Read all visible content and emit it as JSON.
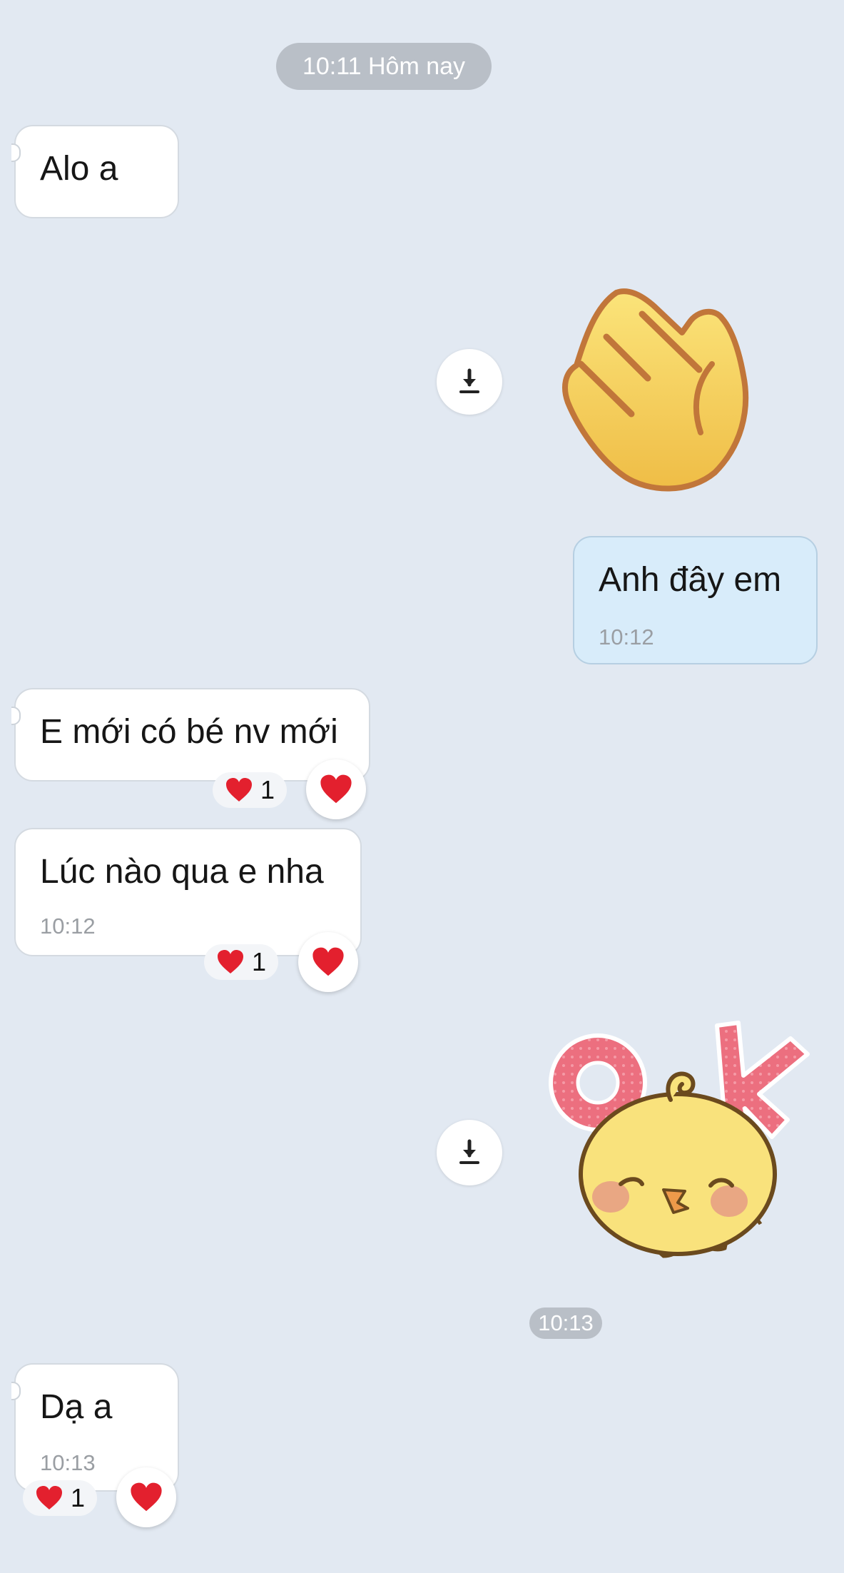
{
  "header_time": "10:11 Hôm nay",
  "messages": [
    {
      "text": "Alo a",
      "time": ""
    },
    {
      "text": "Anh đây em",
      "time": "10:12"
    },
    {
      "text": "E mới có bé nv mới",
      "time": ""
    },
    {
      "text": "Lúc nào qua e nha",
      "time": "10:12"
    },
    {
      "text": "Dạ a",
      "time": "10:13"
    }
  ],
  "mid_time": "10:13",
  "reactions": {
    "emoji": "❤️",
    "counts": [
      "1",
      "1",
      "1"
    ]
  },
  "stickers": [
    {
      "name": "waving-hand-sticker"
    },
    {
      "name": "ok-chick-sticker",
      "text": "OK"
    }
  ],
  "icons": {
    "download": "download-icon",
    "heart": "heart-icon"
  },
  "colors": {
    "background": "#e2e9f2",
    "incoming_bubble": "#ffffff",
    "outgoing_bubble": "#d8ecfa",
    "time_pill": "#b9bfc7",
    "heart": "#e3202e"
  }
}
